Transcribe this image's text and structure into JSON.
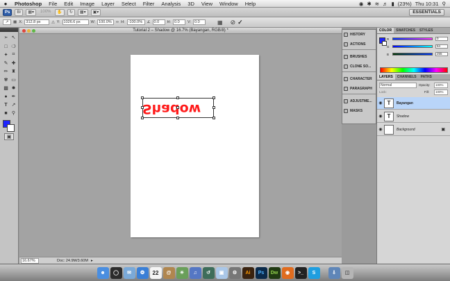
{
  "menubar": {
    "app_name": "Photoshop",
    "menus": [
      "File",
      "Edit",
      "Image",
      "Layer",
      "Select",
      "Filter",
      "Analysis",
      "3D",
      "View",
      "Window",
      "Help"
    ],
    "battery": "(23%)",
    "clock": "Thu 10:31"
  },
  "appbar": {
    "zoom": "100%",
    "workspace": "ESSENTIALS"
  },
  "options": {
    "x_label": "X:",
    "x_value": "312.8 px",
    "y_label": "Y:",
    "y_value": "1026.6 px",
    "w_label": "W:",
    "w_value": "100.0%",
    "h_label": "H:",
    "h_value": "-100.0%",
    "angle_value": "0.0",
    "hskew_label": "H:",
    "hskew_value": "0.0",
    "vskew_label": "V:",
    "vskew_value": "0.0"
  },
  "document": {
    "title": "Tutorial 2 – Shadow @ 16.7% (Bayangan, RGB/8) *",
    "canvas_text": "Shadow",
    "text_color": "#ff1a1a"
  },
  "status": {
    "zoom": "16.67%",
    "doc_info": "Doc: 24.9M/3.60M"
  },
  "dock_panels": [
    {
      "label": "HISTORY",
      "icon": "history-icon"
    },
    {
      "label": "ACTIONS",
      "icon": "actions-icon"
    },
    {
      "label": "BRUSHES",
      "icon": "brushes-icon"
    },
    {
      "label": "CLONE SO...",
      "icon": "clone-source-icon"
    },
    {
      "label": "CHARACTER",
      "icon": "character-icon"
    },
    {
      "label": "PARAGRAPH",
      "icon": "paragraph-icon"
    },
    {
      "label": "ADJUSTME...",
      "icon": "adjustments-icon"
    },
    {
      "label": "MASKS",
      "icon": "masks-icon"
    }
  ],
  "color_panel": {
    "tabs": [
      "COLOR",
      "SWATCHES",
      "STYLES"
    ],
    "r_label": "R",
    "r_value": "0",
    "g_label": "G",
    "g_value": "54",
    "b_label": "B",
    "b_value": "255",
    "foreground": "#1d23ff"
  },
  "layers_panel": {
    "tabs": [
      "LAYERS",
      "CHANNELS",
      "PATHS"
    ],
    "blend_mode": "Normal",
    "opacity_label": "Opacity:",
    "opacity": "100%",
    "lock_label": "Lock:",
    "fill_label": "Fill:",
    "fill": "100%",
    "layers": [
      {
        "name": "Bayangan",
        "thumb": "T",
        "selected": true
      },
      {
        "name": "Shadow",
        "thumb": "T",
        "selected": false
      },
      {
        "name": "Background",
        "thumb": "",
        "selected": false
      }
    ]
  },
  "mac_dock": {
    "app_icons": [
      "Finder",
      "Dashboard",
      "Mail",
      "Safari",
      "iCal",
      "Address Book",
      "iPhoto",
      "iTunes",
      "Time Machine",
      "Preview",
      "System Preferences",
      "Illustrator",
      "Photoshop",
      "Dreamweaver",
      "Firefox",
      "Terminal",
      "Skype",
      "Downloads",
      "Trash"
    ],
    "labels": {
      "ai": "Ai",
      "ps": "Ps",
      "dw": "Dw",
      "cal": "22"
    }
  }
}
